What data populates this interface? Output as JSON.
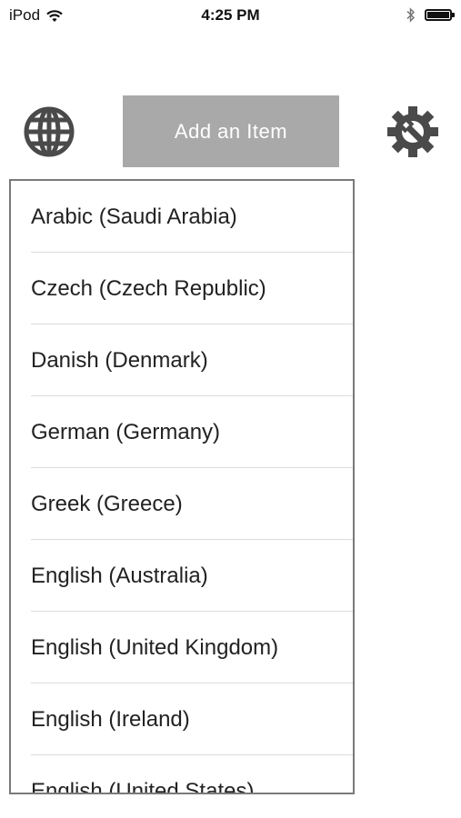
{
  "status_bar": {
    "carrier": "iPod",
    "time": "4:25 PM",
    "battery_level": 1.0
  },
  "toolbar": {
    "globe_icon": "globe-icon",
    "add_item_label": "Add an Item",
    "settings_icon": "gear-wrench-icon"
  },
  "colors": {
    "button_gray": "#a9a9a9",
    "icon_gray": "#4a4a4a",
    "border_gray": "#7a7a7a"
  },
  "languages": [
    {
      "label": "Arabic (Saudi Arabia)"
    },
    {
      "label": "Czech (Czech Republic)"
    },
    {
      "label": "Danish (Denmark)"
    },
    {
      "label": "German (Germany)"
    },
    {
      "label": "Greek (Greece)"
    },
    {
      "label": "English (Australia)"
    },
    {
      "label": "English (United Kingdom)"
    },
    {
      "label": "English (Ireland)"
    },
    {
      "label": "English (United States)"
    }
  ]
}
